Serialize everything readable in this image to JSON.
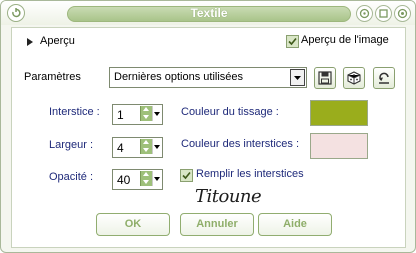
{
  "window": {
    "title": "Textile"
  },
  "preview": {
    "expand_label": "Aperçu",
    "image_preview_label": "Aperçu de l'image",
    "image_preview_checked": true
  },
  "params": {
    "label": "Paramètres",
    "preset_value": "Dernières options utilisées"
  },
  "fields": {
    "interstice": {
      "label": "Interstice :",
      "value": "1"
    },
    "largeur": {
      "label": "Largeur :",
      "value": "4"
    },
    "opacite": {
      "label": "Opacité :",
      "value": "40"
    }
  },
  "colors": {
    "tissage": {
      "label": "Couleur du tissage :",
      "color": "#9aad1c"
    },
    "interstices": {
      "label": "Couleur des interstices :",
      "color": "#f4e1e1"
    }
  },
  "fill": {
    "label": "Remplir les interstices",
    "checked": true
  },
  "signature": "Titoune",
  "buttons": {
    "ok": "OK",
    "cancel": "Annuler",
    "help": "Aide"
  },
  "icons": [
    "restore-icon",
    "help-icon",
    "minimize-icon",
    "close-icon",
    "expand-arrow-icon",
    "dropdown-arrow-icon",
    "save-icon",
    "dice-icon",
    "reset-icon",
    "checkmark-icon"
  ]
}
